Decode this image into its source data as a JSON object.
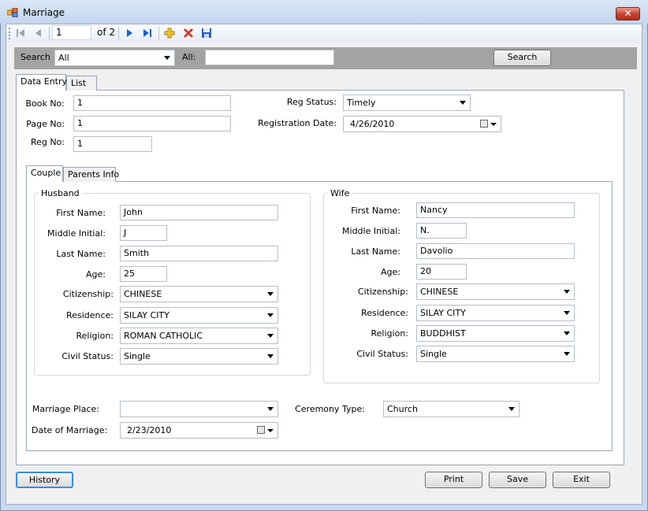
{
  "window": {
    "title": "Marriage",
    "close_glyph": "✕"
  },
  "toolbar": {
    "position": "1",
    "of_text": "of 2",
    "icons": [
      "first-record-icon",
      "previous-record-icon",
      "next-record-icon",
      "last-record-icon",
      "add-icon",
      "delete-icon",
      "save-icon"
    ]
  },
  "search": {
    "label": "Search",
    "field_value": "All",
    "all_label": "All:",
    "text_value": "",
    "button": "Search"
  },
  "tabs": {
    "data_entry": "Data Entry",
    "list": "List"
  },
  "record": {
    "book_no_label": "Book No:",
    "book_no": "1",
    "page_no_label": "Page No:",
    "page_no": "1",
    "reg_no_label": "Reg No:",
    "reg_no": "1",
    "reg_status_label": "Reg Status:",
    "reg_status": "Timely",
    "reg_date_label": "Registration Date:",
    "reg_date": "4/26/2010"
  },
  "subtabs": {
    "couple": "Couple",
    "parents": "Parents Info"
  },
  "husband": {
    "title": "Husband",
    "first_name_label": "First Name:",
    "first_name": "John",
    "middle_label": "Middle Initial:",
    "middle": "J",
    "last_name_label": "Last Name:",
    "last_name": "Smith",
    "age_label": "Age:",
    "age": "25",
    "citizenship_label": "Citizenship:",
    "citizenship": "CHINESE",
    "residence_label": "Residence:",
    "residence": "SILAY CITY",
    "religion_label": "Religion:",
    "religion": "ROMAN CATHOLIC",
    "civil_label": "Civil Status:",
    "civil": "Single"
  },
  "wife": {
    "title": "Wife",
    "first_name_label": "First Name:",
    "first_name": "Nancy",
    "middle_label": "Middle Initial:",
    "middle": "N.",
    "last_name_label": "Last Name:",
    "last_name": "Davolio",
    "age_label": "Age:",
    "age": "20",
    "citizenship_label": "Citizenship:",
    "citizenship": "CHINESE",
    "residence_label": "Residence:",
    "residence": "SILAY CITY",
    "religion_label": "Religion:",
    "religion": "BUDDHIST",
    "civil_label": "Civil Status:",
    "civil": "Single"
  },
  "ceremony": {
    "place_label": "Marriage Place:",
    "place": "",
    "type_label": "Ceremony Type:",
    "type": "Church",
    "date_label": "Date of Marriage:",
    "date": "2/23/2010"
  },
  "buttons": {
    "history": "History",
    "print": "Print",
    "save": "Save",
    "exit": "Exit"
  },
  "colors": {
    "title_bar": "#c3d6ee",
    "search_bar": "#a3a3a3",
    "close_button": "#c4402c"
  }
}
